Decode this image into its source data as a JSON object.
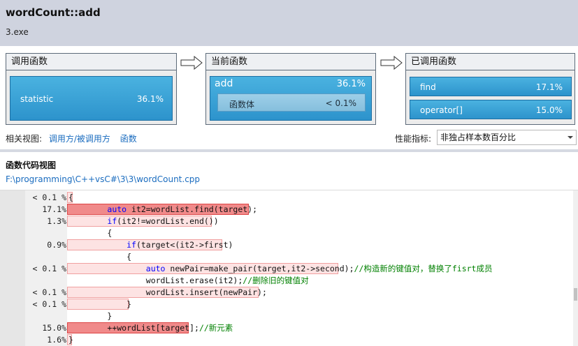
{
  "header": {
    "title": "wordCount::add",
    "subtitle": "3.exe"
  },
  "panels": {
    "callers": {
      "title": "调用函数",
      "items": [
        {
          "label": "statistic",
          "percent": "36.1%"
        }
      ]
    },
    "current": {
      "title": "当前函数",
      "name": "add",
      "percent": "36.1%",
      "body_label": "函数体",
      "body_percent": "< 0.1%"
    },
    "callees": {
      "title": "已调用函数",
      "items": [
        {
          "label": "find",
          "percent": "17.1%"
        },
        {
          "label": "operator[]",
          "percent": "15.0%"
        }
      ]
    }
  },
  "related": {
    "label": "相关视图:",
    "link1": "调用方/被调用方",
    "link2": "函数"
  },
  "metric": {
    "label": "性能指标:",
    "value": "非独占样本数百分比"
  },
  "code_view": {
    "title": "函数代码视图",
    "path": "F:\\programming\\C++vsC#\\3\\3\\wordCount.cpp",
    "lines": [
      {
        "pct": "< 0.1 %",
        "pre": "",
        "kw": "",
        "code": "{",
        "comment": ""
      },
      {
        "pct": "17.1%",
        "pre": "        ",
        "kw": "auto",
        "code": " it2=wordList.find(target);",
        "comment": ""
      },
      {
        "pct": "1.3%",
        "pre": "        ",
        "kw": "if",
        "code": "(it2!=wordList.end())",
        "comment": ""
      },
      {
        "pct": "",
        "pre": "        ",
        "kw": "",
        "code": "{",
        "comment": ""
      },
      {
        "pct": "0.9%",
        "pre": "            ",
        "kw": "if",
        "code": "(target<(it2->first)",
        "comment": ""
      },
      {
        "pct": "",
        "pre": "            ",
        "kw": "",
        "code": "{",
        "comment": ""
      },
      {
        "pct": "< 0.1 %",
        "pre": "                ",
        "kw": "auto",
        "code": " newPair=make_pair(target,it2->second);",
        "comment": "//构造新的键值对，替换了fisrt成员"
      },
      {
        "pct": "",
        "pre": "                ",
        "kw": "",
        "code": "wordList.erase(it2);",
        "comment": "//删除旧的键值对"
      },
      {
        "pct": "< 0.1 %",
        "pre": "                ",
        "kw": "",
        "code": "wordList.insert(newPair);",
        "comment": ""
      },
      {
        "pct": "< 0.1 %",
        "pre": "            ",
        "kw": "",
        "code": "}",
        "comment": ""
      },
      {
        "pct": "",
        "pre": "        ",
        "kw": "",
        "code": "}",
        "comment": ""
      },
      {
        "pct": "15.0%",
        "pre": "        ",
        "kw": "",
        "code": "++wordList[target];",
        "comment": "//新元素"
      },
      {
        "pct": "1.6%",
        "pre": "",
        "kw": "",
        "code": "}",
        "comment": ""
      }
    ]
  }
}
